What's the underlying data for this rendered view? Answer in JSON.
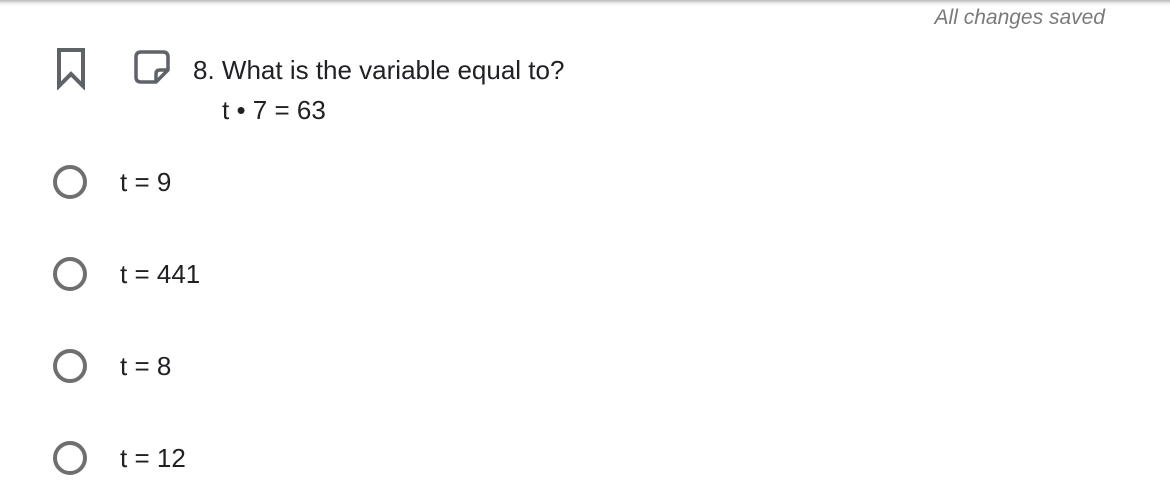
{
  "header": {
    "save_status": "All changes saved"
  },
  "toolbar": {
    "bookmark_icon": "bookmark-icon",
    "note_icon": "note-icon"
  },
  "question": {
    "title": "8. What is the variable equal to?",
    "equation": "t • 7 = 63"
  },
  "choices": [
    {
      "label": "t = 9"
    },
    {
      "label": "t = 441"
    },
    {
      "label": "t = 8"
    },
    {
      "label": "t = 12"
    }
  ],
  "colors": {
    "text": "#202124",
    "muted": "#7a7a7a",
    "radio_border": "#6f6f6f",
    "icon": "#5f6368"
  }
}
